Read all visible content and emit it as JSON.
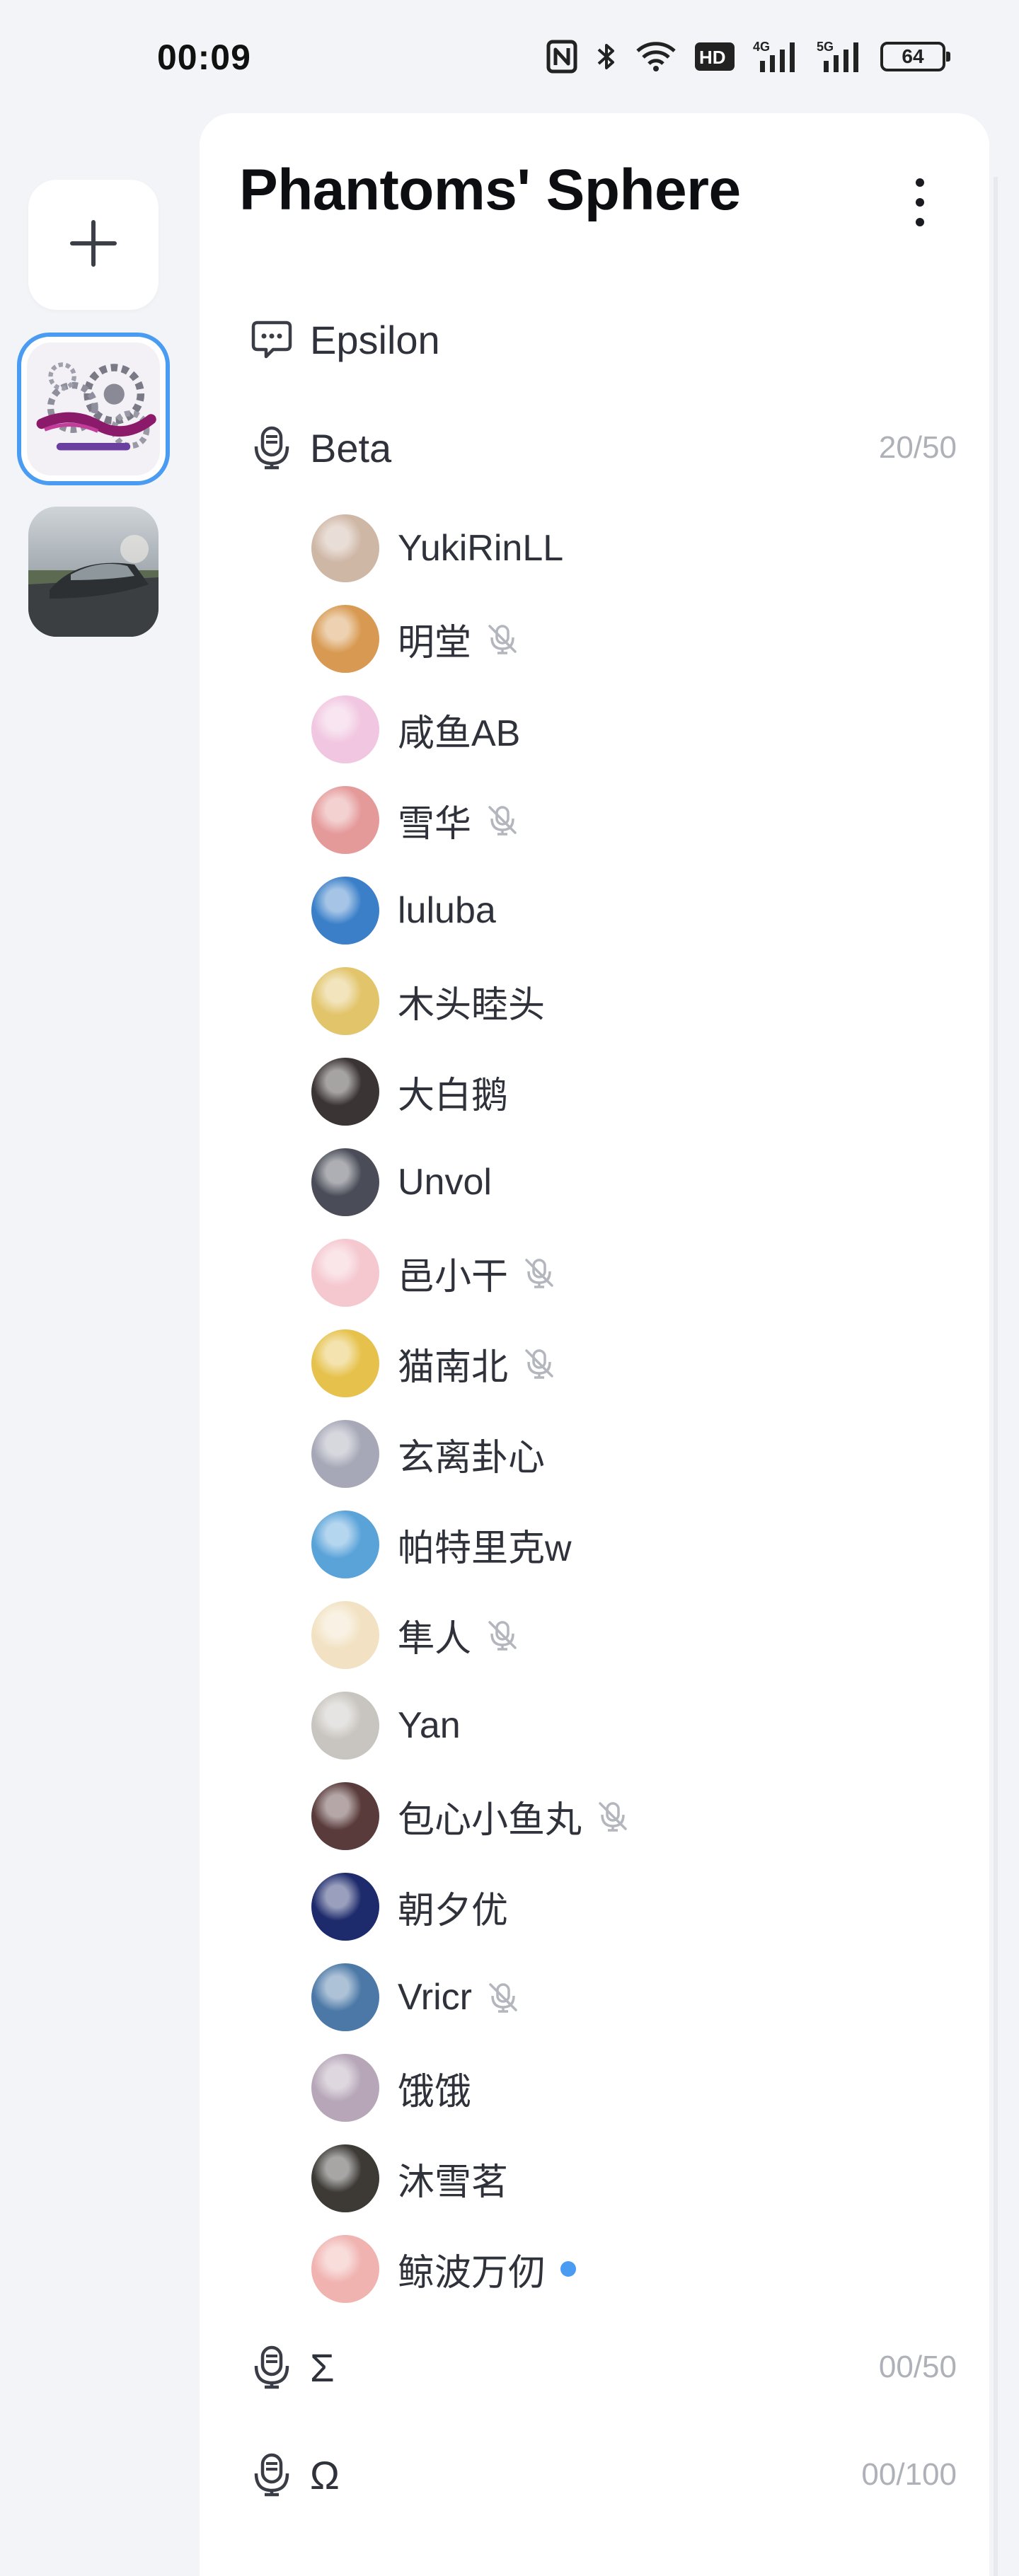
{
  "status_bar": {
    "time": "00:09",
    "battery": "64",
    "network_label": "HD",
    "signal_4g": "4G",
    "signal_5g": "5G",
    "icons": [
      "nfc-icon",
      "bluetooth-icon",
      "wifi-icon",
      "hd-voice-icon",
      "signal-4g-icon",
      "signal-5g-icon",
      "battery-icon"
    ]
  },
  "rail": {
    "add_icon": "plus-icon",
    "servers": [
      {
        "name": "Phantom server",
        "active": true,
        "accent": "#4a9bf2"
      },
      {
        "name": "Car server",
        "active": false
      }
    ]
  },
  "panel": {
    "title": "Phantoms' Sphere",
    "menu_icon": "more-vertical-icon",
    "text_channel": {
      "name": "Epsilon",
      "icon": "chat-bubble-icon"
    },
    "voice_channels": [
      {
        "name": "Beta",
        "count": "20/50",
        "icon": "voice-channel-icon"
      },
      {
        "name": "Σ",
        "count": "00/50",
        "icon": "voice-channel-icon"
      },
      {
        "name": "Ω",
        "count": "00/100",
        "icon": "voice-channel-icon"
      }
    ],
    "members": [
      {
        "name": "YukiRinLL",
        "muted": false,
        "speaking": false,
        "avatar_color": "#cfb7a6"
      },
      {
        "name": "明堂",
        "muted": true,
        "speaking": false,
        "avatar_color": "#d89a52"
      },
      {
        "name": "咸鱼AB",
        "muted": false,
        "speaking": false,
        "avatar_color": "#f1c6e0"
      },
      {
        "name": "雪华",
        "muted": true,
        "speaking": false,
        "avatar_color": "#e59a9a"
      },
      {
        "name": "luluba",
        "muted": false,
        "speaking": false,
        "avatar_color": "#3a7fc8"
      },
      {
        "name": "木头睦头",
        "muted": false,
        "speaking": false,
        "avatar_color": "#e2c46a"
      },
      {
        "name": "大白鹅",
        "muted": false,
        "speaking": false,
        "avatar_color": "#3b3434"
      },
      {
        "name": "Unvol",
        "muted": false,
        "speaking": false,
        "avatar_color": "#4a4d58"
      },
      {
        "name": "邑小干",
        "muted": true,
        "speaking": false,
        "avatar_color": "#f5c7cf"
      },
      {
        "name": "猫南北",
        "muted": true,
        "speaking": false,
        "avatar_color": "#e6c24d"
      },
      {
        "name": "玄离卦心",
        "muted": false,
        "speaking": false,
        "avatar_color": "#a6a8b7"
      },
      {
        "name": "帕特里克w",
        "muted": false,
        "speaking": false,
        "avatar_color": "#5aa3d9"
      },
      {
        "name": "隼人",
        "muted": true,
        "speaking": false,
        "avatar_color": "#f2e2c3"
      },
      {
        "name": "Yan",
        "muted": false,
        "speaking": false,
        "avatar_color": "#c8c4bf"
      },
      {
        "name": "包心小鱼丸",
        "muted": true,
        "speaking": false,
        "avatar_color": "#5a3b3b"
      },
      {
        "name": "朝夕优",
        "muted": false,
        "speaking": false,
        "avatar_color": "#1d2a6b"
      },
      {
        "name": "Vricr",
        "muted": true,
        "speaking": false,
        "avatar_color": "#4b78a6"
      },
      {
        "name": "饿饿",
        "muted": false,
        "speaking": false,
        "avatar_color": "#b6a6b8"
      },
      {
        "name": "沐雪茗",
        "muted": false,
        "speaking": false,
        "avatar_color": "#3d3a36"
      },
      {
        "name": "鲸波万仞",
        "muted": false,
        "speaking": true,
        "avatar_color": "#f0b3b0"
      }
    ]
  }
}
